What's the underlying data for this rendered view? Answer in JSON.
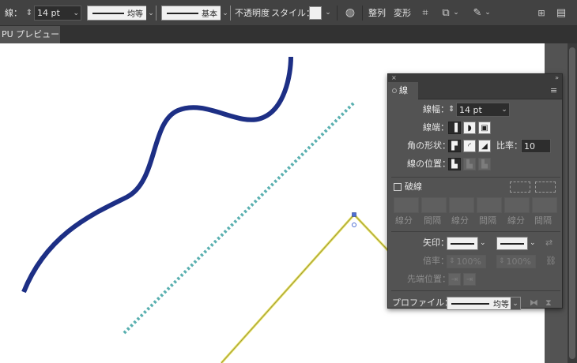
{
  "control_bar": {
    "stroke_label": "線：",
    "stroke_weight_value": "14 pt",
    "variable_width_label": "均等",
    "brush_label": "基本",
    "opacity_label": "不透明度",
    "style_label": "スタイル：",
    "align_label": "整列",
    "transform_label": "変形"
  },
  "document": {
    "tab_label": "PU プレビュー)"
  },
  "stroke_panel": {
    "title_close": "×",
    "title_collapse": "»",
    "tab_label": "線",
    "menu_icon": "≡",
    "weight_label": "線幅：",
    "weight_value": "14 pt",
    "cap_label": "線端：",
    "corner_label": "角の形状：",
    "limit_label": "比率：",
    "limit_value": "10",
    "align_label": "線の位置：",
    "dashed_label": "破線",
    "dash_labels": [
      "線分",
      "間隔",
      "線分",
      "間隔",
      "線分",
      "間隔"
    ],
    "arrowheads_label": "矢印：",
    "scale_label": "倍率：",
    "scale_start": "100%",
    "scale_end": "100%",
    "arrow_align_label": "先端位置：",
    "profile_label": "プロファイル：",
    "profile_value": "均等"
  },
  "artwork": {
    "navy_stroke": "#1d2f85",
    "teal_dotted": "#5ab0b0",
    "yellow_path": "#e8e05a"
  }
}
